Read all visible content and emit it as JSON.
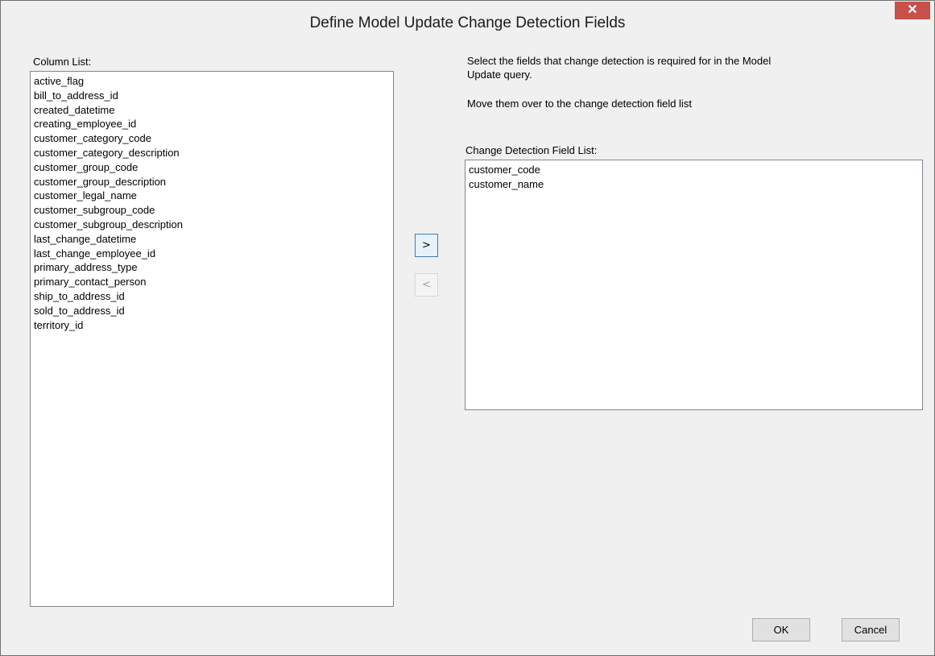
{
  "window": {
    "title": "Define Model Update Change Detection Fields",
    "close_glyph": "✕"
  },
  "column_list": {
    "label": "Column List:",
    "items": [
      "active_flag",
      "bill_to_address_id",
      "created_datetime",
      "creating_employee_id",
      "customer_category_code",
      "customer_category_description",
      "customer_group_code",
      "customer_group_description",
      "customer_legal_name",
      "customer_subgroup_code",
      "customer_subgroup_description",
      "last_change_datetime",
      "last_change_employee_id",
      "primary_address_type",
      "primary_contact_person",
      "ship_to_address_id",
      "sold_to_address_id",
      "territory_id"
    ]
  },
  "instructions": {
    "line1": "Select the fields that change detection is required for in the Model Update query.",
    "line2": "Move them over to the change detection field list"
  },
  "detection_list": {
    "label": "Change Detection Field List:",
    "items": [
      "customer_code",
      "customer_name"
    ]
  },
  "transfer": {
    "add_label": ">",
    "remove_label": "<"
  },
  "buttons": {
    "ok_label": "OK",
    "cancel_label": "Cancel"
  }
}
